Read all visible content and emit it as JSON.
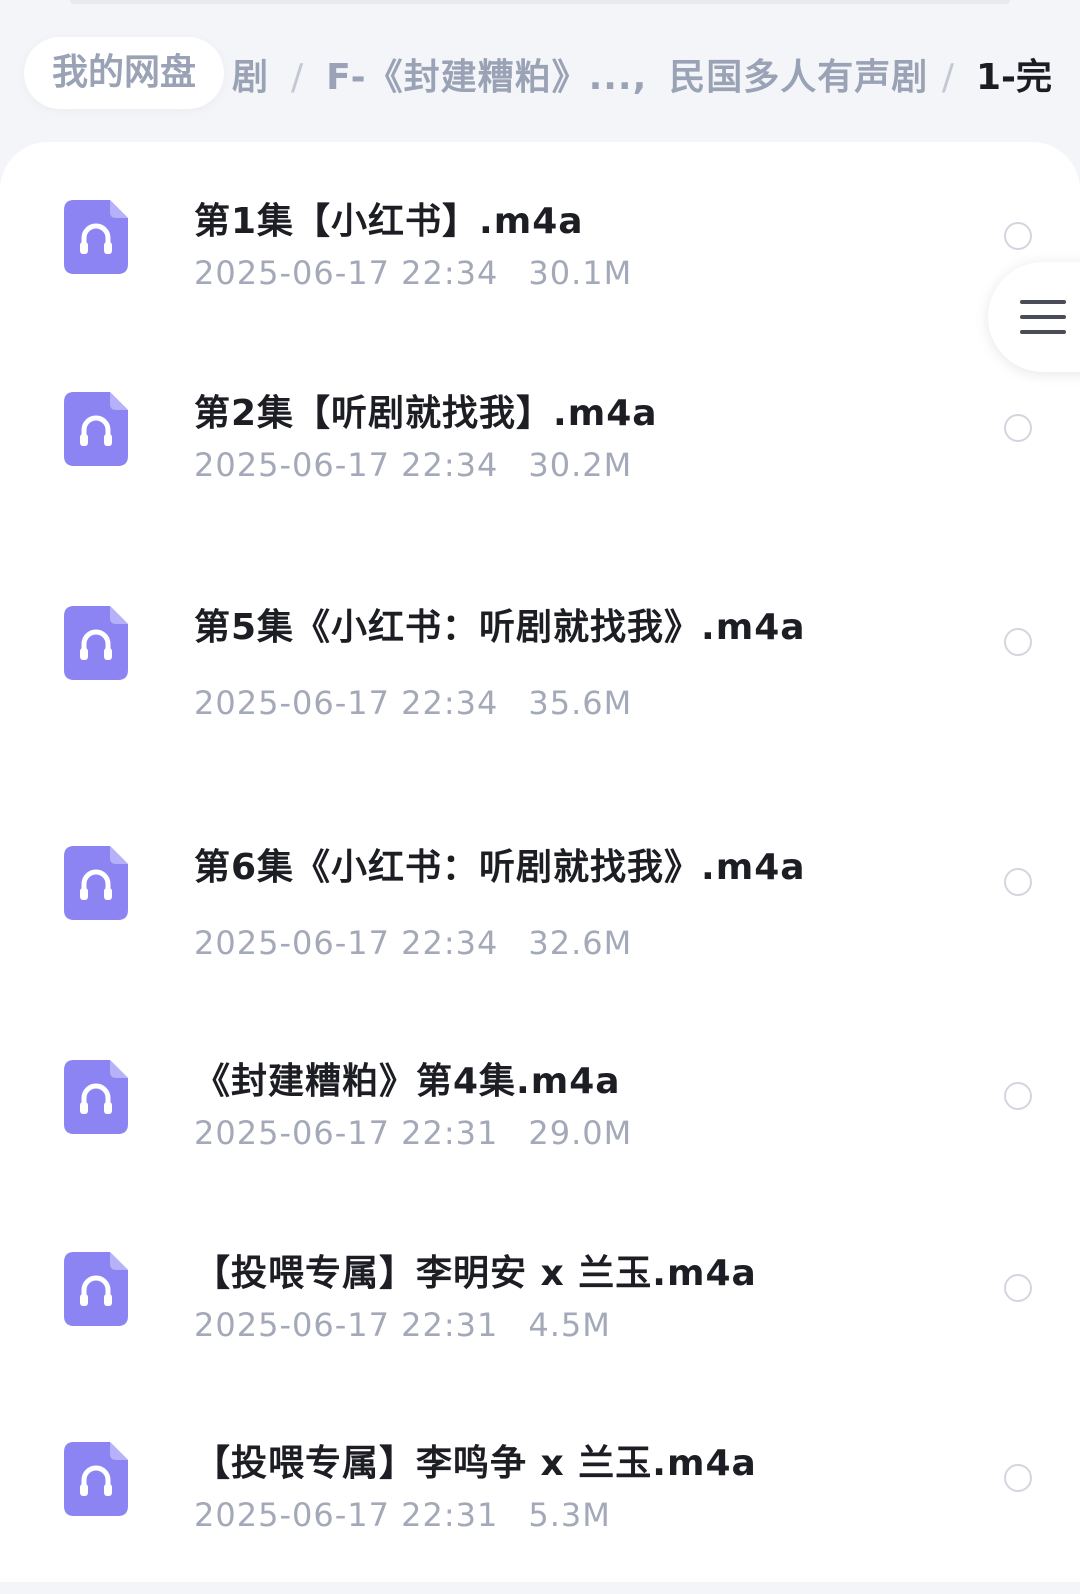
{
  "breadcrumb": {
    "home": "我的网盘",
    "trail_text": "剧",
    "crumb_1": "F-《封建糟粕》...,",
    "crumb_2": "民国多人有声剧",
    "current": "1-完",
    "separator": "/"
  },
  "menu": {
    "icon": "hamburger-menu-icon"
  },
  "colors": {
    "icon_purple": "#8d84f3",
    "title_text": "#1d1e24",
    "meta_text": "#a3a9b8"
  },
  "files": [
    {
      "name": "第1集【小红书】.m4a",
      "date": "2025-06-17 22:34",
      "size": "30.1M"
    },
    {
      "name": "第2集【听剧就找我】.m4a",
      "date": "2025-06-17 22:34",
      "size": "30.2M"
    },
    {
      "name": "第5集《小红书：听剧就找我》.m4a",
      "date": "2025-06-17 22:34",
      "size": "35.6M"
    },
    {
      "name": "第6集《小红书：听剧就找我》.m4a",
      "date": "2025-06-17 22:34",
      "size": "32.6M"
    },
    {
      "name": "《封建糟粕》第4集.m4a",
      "date": "2025-06-17 22:31",
      "size": "29.0M"
    },
    {
      "name": "【投喂专属】李明安 x 兰玉.m4a",
      "date": "2025-06-17 22:31",
      "size": "4.5M"
    },
    {
      "name": "【投喂专属】李鸣争 x 兰玉.m4a",
      "date": "2025-06-17 22:31",
      "size": "5.3M"
    }
  ]
}
